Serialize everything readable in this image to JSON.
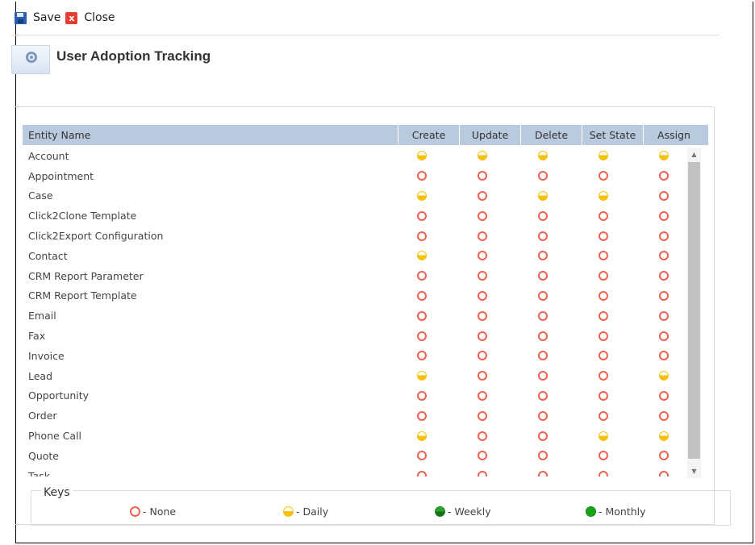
{
  "toolbar": {
    "save_label": "Save",
    "close_label": "Close"
  },
  "header": {
    "title": "User Adoption Tracking"
  },
  "grid": {
    "columns": [
      "Entity Name",
      "Create",
      "Update",
      "Delete",
      "Set State",
      "Assign"
    ],
    "rows": [
      {
        "name": "Account",
        "values": [
          "daily",
          "daily",
          "daily",
          "daily",
          "daily"
        ]
      },
      {
        "name": "Appointment",
        "values": [
          "none",
          "none",
          "none",
          "none",
          "none"
        ]
      },
      {
        "name": "Case",
        "values": [
          "daily",
          "none",
          "daily",
          "daily",
          "none"
        ]
      },
      {
        "name": "Click2Clone Template",
        "values": [
          "none",
          "none",
          "none",
          "none",
          "none"
        ]
      },
      {
        "name": "Click2Export Configuration",
        "values": [
          "none",
          "none",
          "none",
          "none",
          "none"
        ]
      },
      {
        "name": "Contact",
        "values": [
          "daily",
          "none",
          "none",
          "none",
          "none"
        ]
      },
      {
        "name": "CRM Report Parameter",
        "values": [
          "none",
          "none",
          "none",
          "none",
          "none"
        ]
      },
      {
        "name": "CRM Report Template",
        "values": [
          "none",
          "none",
          "none",
          "none",
          "none"
        ]
      },
      {
        "name": "Email",
        "values": [
          "none",
          "none",
          "none",
          "none",
          "none"
        ]
      },
      {
        "name": "Fax",
        "values": [
          "none",
          "none",
          "none",
          "none",
          "none"
        ]
      },
      {
        "name": "Invoice",
        "values": [
          "none",
          "none",
          "none",
          "none",
          "none"
        ]
      },
      {
        "name": "Lead",
        "values": [
          "daily",
          "none",
          "none",
          "none",
          "daily"
        ]
      },
      {
        "name": "Opportunity",
        "values": [
          "none",
          "none",
          "none",
          "none",
          "none"
        ]
      },
      {
        "name": "Order",
        "values": [
          "none",
          "none",
          "none",
          "none",
          "none"
        ]
      },
      {
        "name": "Phone Call",
        "values": [
          "daily",
          "none",
          "none",
          "daily",
          "daily"
        ]
      },
      {
        "name": "Quote",
        "values": [
          "none",
          "none",
          "none",
          "none",
          "none"
        ]
      },
      {
        "name": "Task",
        "values": [
          "none",
          "none",
          "none",
          "none",
          "none"
        ]
      }
    ]
  },
  "keys": {
    "label": "Keys",
    "items": [
      {
        "type": "none",
        "label": "- None"
      },
      {
        "type": "daily",
        "label": "- Daily"
      },
      {
        "type": "weekly",
        "label": "- Weekly"
      },
      {
        "type": "monthly",
        "label": "- Monthly"
      }
    ]
  },
  "colors": {
    "none": "#f0604f",
    "daily": "#f4c20d",
    "weekly": "#1a8c1a",
    "monthly": "#19a319",
    "header_bg": "#b9c9de"
  },
  "icons": {
    "save": "floppy-disk-icon",
    "close": "close-x-icon",
    "app": "gear-settings-icon",
    "scroll_up": "caret-up-icon",
    "scroll_down": "caret-down-icon"
  }
}
